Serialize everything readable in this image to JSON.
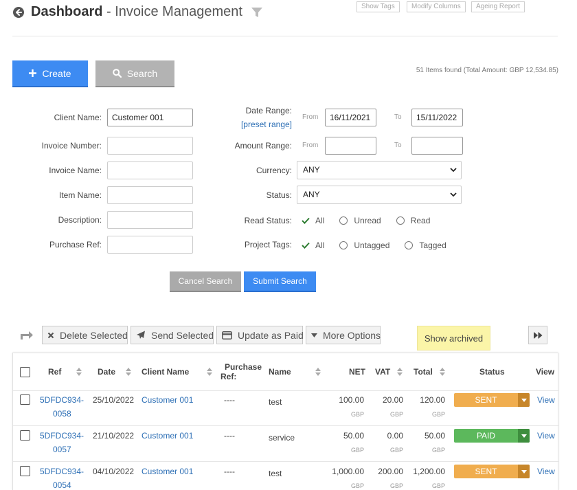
{
  "header": {
    "title_bold": "Dashboard",
    "title_sep": " - ",
    "title_rest": "Invoice Management",
    "show_tags": "Show Tags",
    "modify_columns": "Modify Columns",
    "ageing_report": "Ageing Report"
  },
  "actions": {
    "create": "Create",
    "search": "Search",
    "items_found": "51 Items found (Total Amount: GBP 12,534.85)"
  },
  "form": {
    "client_name_label": "Client Name:",
    "client_name_value": "Customer 001",
    "invoice_number_label": "Invoice Number:",
    "invoice_name_label": "Invoice Name:",
    "item_name_label": "Item Name:",
    "description_label": "Description:",
    "purchase_ref_label": "Purchase Ref:",
    "date_range_label": "Date Range:",
    "preset_range": "[preset range]",
    "from": "From",
    "to": "To",
    "date_from": "16/11/2021",
    "date_to": "15/11/2022",
    "amount_range_label": "Amount Range:",
    "currency_label": "Currency:",
    "currency_value": "ANY",
    "status_label": "Status:",
    "status_value": "ANY",
    "read_status_label": "Read Status:",
    "read_all": "All",
    "read_unread": "Unread",
    "read_read": "Read",
    "project_tags_label": "Project Tags:",
    "tags_all": "All",
    "tags_untagged": "Untagged",
    "tags_tagged": "Tagged",
    "cancel_search": "Cancel Search",
    "submit_search": "Submit Search"
  },
  "toolbar": {
    "delete_selected": "Delete Selected",
    "send_selected": "Send Selected",
    "update_as_paid": "Update as Paid",
    "more_options": "More Options",
    "show_archived": "Show archived"
  },
  "table": {
    "headers": {
      "ref": "Ref",
      "date": "Date",
      "client_name": "Client Name",
      "purchase_ref_1": "Purchase",
      "purchase_ref_2": "Ref:",
      "name": "Name",
      "net": "NET",
      "vat": "VAT",
      "total": "Total",
      "status": "Status",
      "view": "View"
    },
    "rows": [
      {
        "ref1": "5DFDC934-",
        "ref2": "0058",
        "date": "25/10/2022",
        "client": "Customer 001",
        "purchase_ref": "----",
        "name": "test",
        "net": "100.00",
        "vat": "20.00",
        "total": "120.00",
        "currency": "GBP",
        "status": "SENT",
        "view": "View"
      },
      {
        "ref1": "5DFDC934-",
        "ref2": "0057",
        "date": "21/10/2022",
        "client": "Customer 001",
        "purchase_ref": "----",
        "name": "service",
        "net": "50.00",
        "vat": "0.00",
        "total": "50.00",
        "currency": "GBP",
        "status": "PAID",
        "view": "View"
      },
      {
        "ref1": "5DFDC934-",
        "ref2": "0054",
        "date": "04/10/2022",
        "client": "Customer 001",
        "purchase_ref": "----",
        "name": "test",
        "net": "1,000.00",
        "vat": "200.00",
        "total": "1,200.00",
        "currency": "GBP",
        "status": "SENT",
        "view": "View"
      }
    ]
  },
  "colors": {
    "primary": "#3d8bf2",
    "sent": "#f0ad4e",
    "sent_dark": "#c7862a",
    "paid": "#5cb85c",
    "paid_dark": "#3e8e3e",
    "check": "#2e7d32",
    "link": "#2d6fb5"
  }
}
